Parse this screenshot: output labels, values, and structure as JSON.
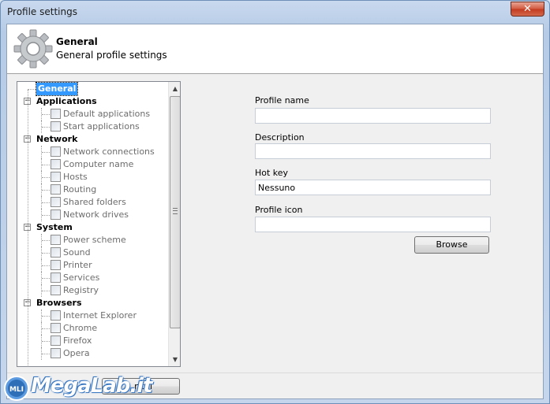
{
  "window": {
    "title": "Profile settings",
    "close_glyph": "✕"
  },
  "header": {
    "icon": "gear-icon",
    "title": "General",
    "subtitle": "General profile settings"
  },
  "tree": {
    "items": [
      {
        "label": "General",
        "level": 0,
        "selected": true
      },
      {
        "label": "Applications",
        "level": 0,
        "expander": "−"
      },
      {
        "label": "Default applications",
        "level": 1
      },
      {
        "label": "Start applications",
        "level": 1
      },
      {
        "label": "Network",
        "level": 0,
        "expander": "−"
      },
      {
        "label": "Network connections",
        "level": 1
      },
      {
        "label": "Computer name",
        "level": 1
      },
      {
        "label": "Hosts",
        "level": 1
      },
      {
        "label": "Routing",
        "level": 1
      },
      {
        "label": "Shared folders",
        "level": 1
      },
      {
        "label": "Network drives",
        "level": 1
      },
      {
        "label": "System",
        "level": 0,
        "expander": "−"
      },
      {
        "label": "Power scheme",
        "level": 1
      },
      {
        "label": "Sound",
        "level": 1
      },
      {
        "label": "Printer",
        "level": 1
      },
      {
        "label": "Services",
        "level": 1
      },
      {
        "label": "Registry",
        "level": 1
      },
      {
        "label": "Browsers",
        "level": 0,
        "expander": "−"
      },
      {
        "label": "Internet Explorer",
        "level": 1
      },
      {
        "label": "Chrome",
        "level": 1
      },
      {
        "label": "Firefox",
        "level": 1
      },
      {
        "label": "Opera",
        "level": 1
      }
    ]
  },
  "form": {
    "profile_name_label": "Profile name",
    "profile_name_value": "",
    "description_label": "Description",
    "description_value": "",
    "hotkey_label": "Hot key",
    "hotkey_value": "Nessuno",
    "profile_icon_label": "Profile icon",
    "profile_icon_value": "",
    "browse_label": "Browse"
  },
  "footer": {
    "cancel_label_visible": "ncel"
  },
  "watermark": {
    "text": "MegaLab.it",
    "badge": "MLI"
  }
}
